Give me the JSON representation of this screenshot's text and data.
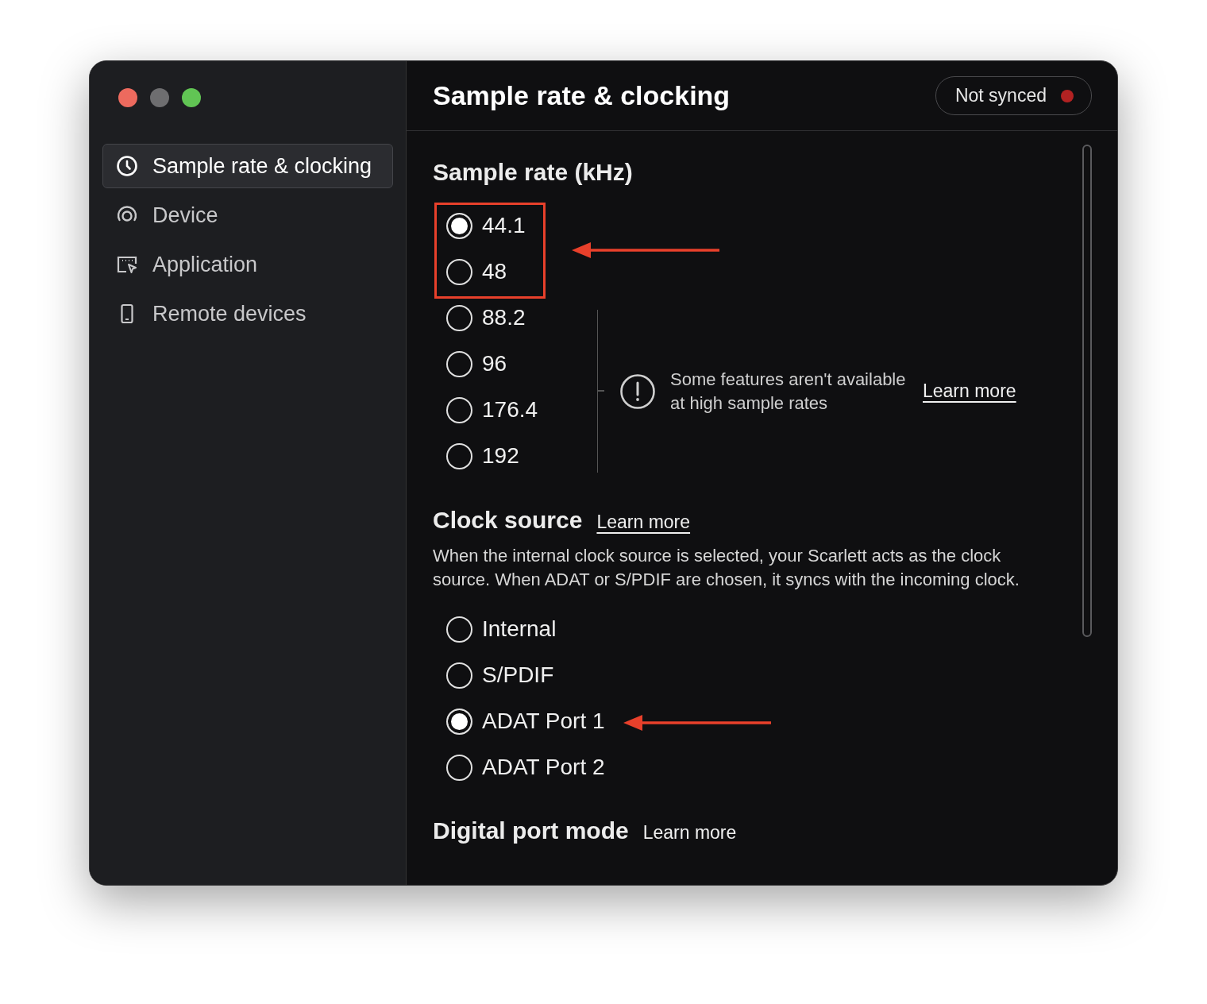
{
  "sidebar": {
    "items": [
      {
        "label": "Sample rate & clocking",
        "kind": "clock",
        "selected": true
      },
      {
        "label": "Device",
        "kind": "device",
        "selected": false
      },
      {
        "label": "Application",
        "kind": "application",
        "selected": false
      },
      {
        "label": "Remote devices",
        "kind": "phone",
        "selected": false
      }
    ]
  },
  "header": {
    "title": "Sample rate & clocking",
    "status": {
      "label": "Not synced",
      "synced": false
    }
  },
  "sample_rate": {
    "title": "Sample rate (kHz)",
    "options": [
      {
        "label": "44.1",
        "selected": true
      },
      {
        "label": "48",
        "selected": false
      },
      {
        "label": "88.2",
        "selected": false
      },
      {
        "label": "96",
        "selected": false
      },
      {
        "label": "176.4",
        "selected": false
      },
      {
        "label": "192",
        "selected": false
      }
    ],
    "notice": {
      "text": "Some features aren't available at high sample rates",
      "link": "Learn more"
    }
  },
  "clock_source": {
    "title": "Clock source",
    "link": "Learn more",
    "description": "When the internal clock source is selected, your Scarlett acts as the clock source. When ADAT or S/PDIF are chosen, it syncs with the incoming clock.",
    "options": [
      {
        "label": "Internal",
        "selected": false
      },
      {
        "label": "S/PDIF",
        "selected": false
      },
      {
        "label": "ADAT Port 1",
        "selected": true
      },
      {
        "label": "ADAT Port 2",
        "selected": false
      }
    ]
  },
  "digital_port_mode": {
    "title": "Digital port mode",
    "link": "Learn more"
  }
}
